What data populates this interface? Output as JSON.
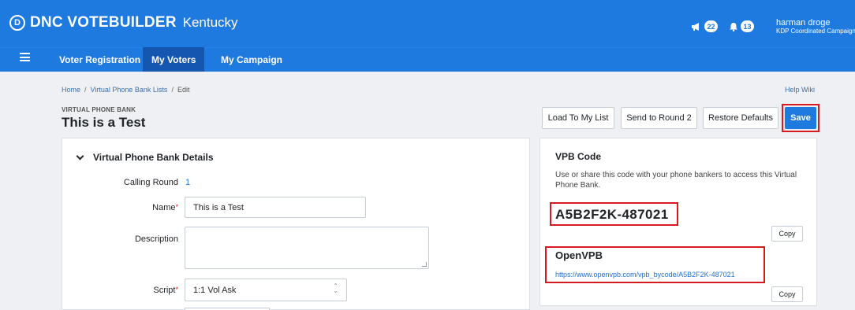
{
  "header": {
    "logo_letter": "D",
    "brand": "DNC VOTEBUILDER",
    "state": "Kentucky",
    "announcements_count": "22",
    "notifications_count": "13",
    "user_name": "harman droge",
    "user_org": "KDP Coordinated Campaign",
    "brand_color": "#1f7ae0"
  },
  "nav": {
    "tabs": [
      {
        "label": "Voter Registration"
      },
      {
        "label": "My Voters"
      },
      {
        "label": "My Campaign"
      }
    ],
    "active": "My Voters"
  },
  "breadcrumb": {
    "home": "Home",
    "lists": "Virtual Phone Bank Lists",
    "current": "Edit",
    "separator": "/"
  },
  "help_link": "Help Wiki",
  "page": {
    "eyebrow": "VIRTUAL PHONE BANK",
    "title": "This is a Test"
  },
  "actions": {
    "load": "Load To My List",
    "round2": "Send to Round 2",
    "restore": "Restore Defaults",
    "save": "Save"
  },
  "details": {
    "section_title": "Virtual Phone Bank Details",
    "calling_round_label": "Calling Round",
    "calling_round_value": "1",
    "name_label": "Name",
    "name_value": "This is a Test",
    "description_label": "Description",
    "description_value": "",
    "script_label": "Script",
    "script_value": "1:1 Vol Ask",
    "required_mark": "*"
  },
  "vpb": {
    "heading": "VPB Code",
    "description": "Use or share this code with your phone bankers to access this Virtual Phone Bank.",
    "code": "A5B2F2K-487021",
    "copy_label": "Copy",
    "openvpb_title": "OpenVPB",
    "openvpb_url": "https://www.openvpb.com/vpb_bycode/A5B2F2K-487021"
  },
  "colors": {
    "highlight": "#d71920",
    "active_tab": "#1557b0"
  }
}
